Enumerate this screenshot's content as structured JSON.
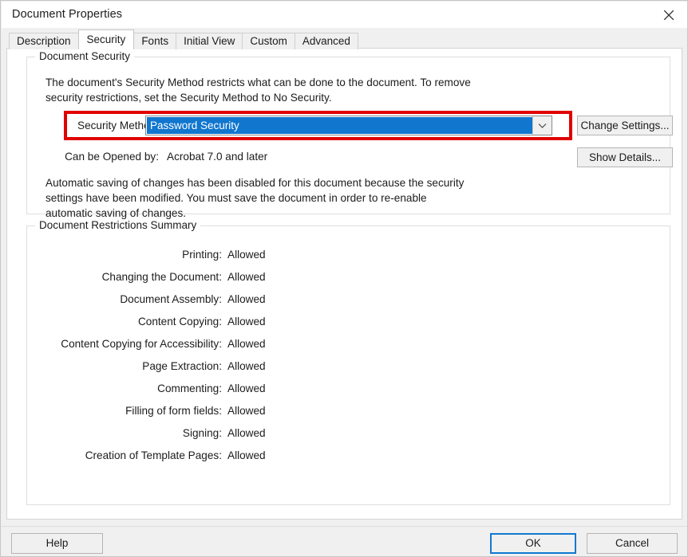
{
  "window": {
    "title": "Document Properties",
    "close_icon": "close-icon"
  },
  "tabs": [
    {
      "label": "Description",
      "selected": false
    },
    {
      "label": "Security",
      "selected": true
    },
    {
      "label": "Fonts",
      "selected": false
    },
    {
      "label": "Initial View",
      "selected": false
    },
    {
      "label": "Custom",
      "selected": false
    },
    {
      "label": "Advanced",
      "selected": false
    }
  ],
  "document_security": {
    "group_title": "Document Security",
    "description": "The document's Security Method restricts what can be done to the document. To remove security restrictions, set the Security Method to No Security.",
    "security_method_label": "Security Method:",
    "security_method_value": "Password Security",
    "security_method_dropdown_icon": "chevron-down-icon",
    "opened_by_label": "Can be Opened by:",
    "opened_by_value": "Acrobat 7.0 and later",
    "auto_save_note": "Automatic saving of changes has been disabled for this document because the security settings have been modified. You must save the document in order to re-enable automatic saving of changes.",
    "change_settings_label": "Change Settings...",
    "show_details_label": "Show Details...",
    "annotation_color": "#e00000",
    "selection_color": "#1076ce"
  },
  "restrictions": {
    "group_title": "Document Restrictions Summary",
    "rows": [
      {
        "label": "Printing:",
        "value": "Allowed"
      },
      {
        "label": "Changing the Document:",
        "value": "Allowed"
      },
      {
        "label": "Document Assembly:",
        "value": "Allowed"
      },
      {
        "label": "Content Copying:",
        "value": "Allowed"
      },
      {
        "label": "Content Copying for Accessibility:",
        "value": "Allowed"
      },
      {
        "label": "Page Extraction:",
        "value": "Allowed"
      },
      {
        "label": "Commenting:",
        "value": "Allowed"
      },
      {
        "label": "Filling of form fields:",
        "value": "Allowed"
      },
      {
        "label": "Signing:",
        "value": "Allowed"
      },
      {
        "label": "Creation of Template Pages:",
        "value": "Allowed"
      }
    ]
  },
  "footer": {
    "help_label": "Help",
    "ok_label": "OK",
    "cancel_label": "Cancel",
    "focus_color": "#0f79d0"
  }
}
